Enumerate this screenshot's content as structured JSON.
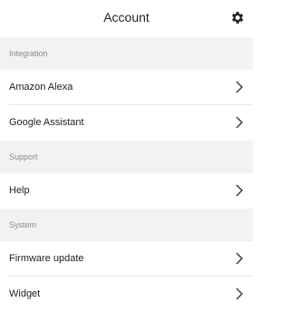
{
  "header": {
    "title": "Account",
    "settings_icon": "gear-icon"
  },
  "sections": [
    {
      "label": "Integration",
      "items": [
        "Amazon Alexa",
        "Google Assistant"
      ]
    },
    {
      "label": "Support",
      "items": [
        "Help"
      ]
    },
    {
      "label": "System",
      "items": [
        "Firmware update",
        "Widget"
      ]
    }
  ],
  "colors": {
    "section_bg": "#f2f2f2",
    "divider": "#e6e6e6",
    "text": "#222222",
    "muted": "#8a8a8a"
  }
}
